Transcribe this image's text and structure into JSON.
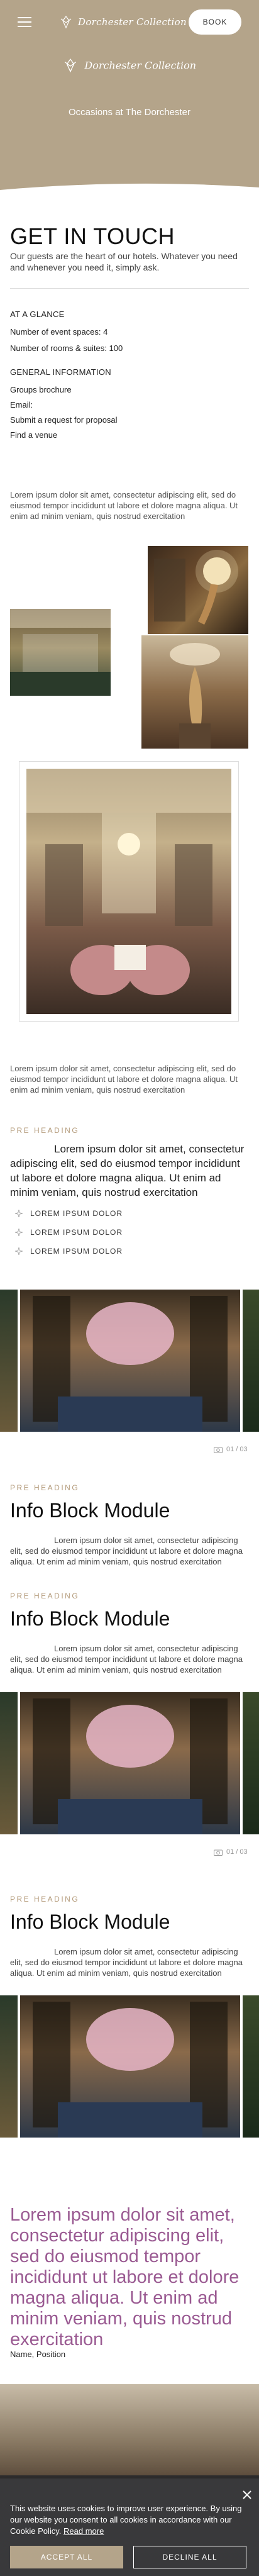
{
  "header": {
    "brand": "Dorchester Collection",
    "book_label": "BOOK",
    "hero_logo": "Dorchester Collection",
    "hero_subtitle": "Occasions at The Dorchester"
  },
  "contact": {
    "title": "GET IN TOUCH",
    "description": "Our guests are the heart of our hotels. Whatever you need and whenever you need it, simply ask.",
    "glance_heading": "AT A GLANCE",
    "event_spaces": "Number of event spaces: 4",
    "rooms_suites": "Number of rooms & suites: 100",
    "general_heading": "GENERAL INFORMATION",
    "links": [
      "Groups brochure",
      "Email:",
      "Submit a request for proposal",
      "Find a venue"
    ]
  },
  "lorem": {
    "para": "Lorem ipsum dolor sit amet, consectetur adipiscing elit, sed do eiusmod tempor incididunt ut labore et dolore magna aliqua. Ut enim ad minim veniam, quis nostrud exercitation",
    "lead": "Lorem ipsum dolor sit amet, consectetur adipiscing elit, sed do eiusmod tempor incididunt ut labore et dolore magna aliqua. Ut enim ad minim veniam, quis nostrud exercitation",
    "quote": "Lorem ipsum dolor sit amet, consectetur adipiscing elit, sed do eiusmod tempor incididunt ut labore et dolore magna aliqua. Ut enim ad minim veniam, quis nostrud exercitation",
    "quote_by": "Name, Position"
  },
  "blocks": {
    "pre_heading": "PRE HEADING",
    "bullets": [
      "LOREM IPSUM DOLOR",
      "LOREM IPSUM DOLOR",
      "LOREM IPSUM DOLOR"
    ],
    "info_title": "Info Block Module",
    "counter": "01 / 03"
  },
  "cookie": {
    "text": "This website uses cookies to improve user experience. By using our website you consent to all cookies in accordance with our Cookie Policy.",
    "read_more": "Read more",
    "accept": "ACCEPT ALL",
    "decline": "DECLINE ALL"
  },
  "colors": {
    "brand_tan": "#b4a48a",
    "accent_purple": "#9a5a92",
    "pre_heading": "#b39a7a"
  }
}
